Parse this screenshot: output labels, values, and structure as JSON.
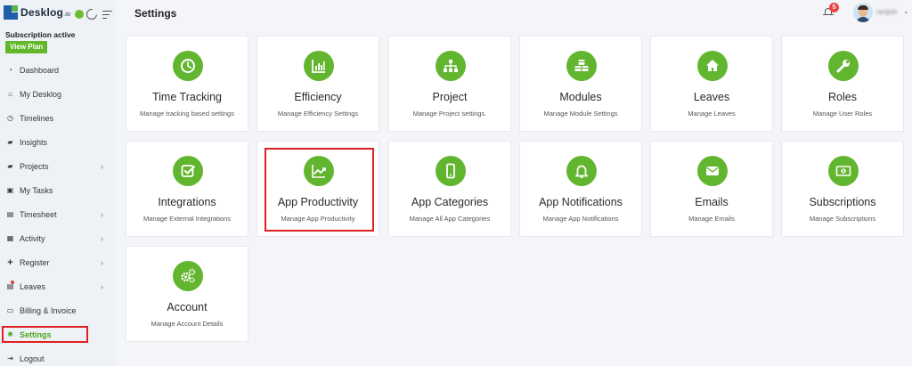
{
  "brand": {
    "name": "Desklog",
    "suffix": ".io"
  },
  "subscription": {
    "status": "Subscription active",
    "plan_button": "View Plan"
  },
  "sidebar": {
    "items": [
      {
        "label": "Dashboard",
        "icon": "dashboard-icon"
      },
      {
        "label": "My Desklog",
        "icon": "home-icon"
      },
      {
        "label": "Timelines",
        "icon": "clock-icon"
      },
      {
        "label": "Insights",
        "icon": "book-icon"
      },
      {
        "label": "Projects",
        "icon": "book-icon",
        "has_submenu": true
      },
      {
        "label": "My Tasks",
        "icon": "tasks-icon"
      },
      {
        "label": "Timesheet",
        "icon": "calendar-icon",
        "has_submenu": true
      },
      {
        "label": "Activity",
        "icon": "grid-icon",
        "has_submenu": true
      },
      {
        "label": "Register",
        "icon": "plus-icon",
        "has_submenu": true
      },
      {
        "label": "Leaves",
        "icon": "calendar-icon",
        "has_submenu": true,
        "notification": true
      },
      {
        "label": "Billing & Invoice",
        "icon": "file-icon"
      },
      {
        "label": "Settings",
        "icon": "gear-icon",
        "active": true
      },
      {
        "label": "Logout",
        "icon": "logout-icon"
      }
    ]
  },
  "header": {
    "title": "Settings",
    "notification_count": "5",
    "username": "renjish"
  },
  "cards": [
    {
      "title": "Time Tracking",
      "subtitle": "Manage tracking based settings",
      "icon": "clock-icon"
    },
    {
      "title": "Efficiency",
      "subtitle": "Manage Efficiency Settings",
      "icon": "bar-chart-icon"
    },
    {
      "title": "Project",
      "subtitle": "Manage Project settings.",
      "icon": "sitemap-icon"
    },
    {
      "title": "Modules",
      "subtitle": "Manage Module Settings",
      "icon": "cubes-icon"
    },
    {
      "title": "Leaves",
      "subtitle": "Manage Leaves",
      "icon": "home-icon"
    },
    {
      "title": "Roles",
      "subtitle": "Manage User Roles",
      "icon": "wrench-icon"
    },
    {
      "title": "Integrations",
      "subtitle": "Manage External Integrations",
      "icon": "check-square-icon"
    },
    {
      "title": "App Productivity",
      "subtitle": "Manage App Productivity",
      "icon": "line-chart-icon"
    },
    {
      "title": "App Categories",
      "subtitle": "Manage All App Categories",
      "icon": "mobile-icon"
    },
    {
      "title": "App Notifications",
      "subtitle": "Manage App Notifications",
      "icon": "bell-icon"
    },
    {
      "title": "Emails",
      "subtitle": "Manage Emails",
      "icon": "envelope-icon"
    },
    {
      "title": "Subscriptions",
      "subtitle": "Manage Subscriptions",
      "icon": "money-icon"
    },
    {
      "title": "Account",
      "subtitle": "Manage Account Details",
      "icon": "gears-icon"
    }
  ],
  "colors": {
    "accent": "#62b52f",
    "highlight": "#e02020",
    "active_nav": "#4aa81f"
  }
}
